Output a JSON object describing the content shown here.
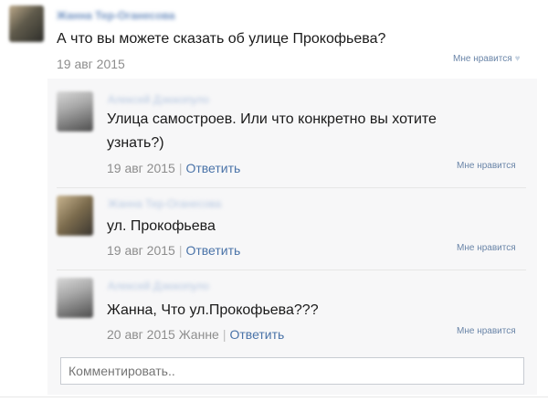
{
  "post": {
    "author": "Жанна Тер-Оганесова",
    "text": "А что вы можете сказать об улице Прокофьева?",
    "date": "19 авг 2015",
    "like_label": "Мне нравится"
  },
  "replies": [
    {
      "author": "Алексей Дзюкопуло",
      "text": "Улица самостроев. Или что конкретно вы хотите узнать?)",
      "date": "19 авг 2015",
      "reply_label": "Ответить",
      "like_label": "Мне нравится"
    },
    {
      "author": "Жанна Тер-Оганесова",
      "text": "ул. Прокофьева",
      "date": "19 авг 2015",
      "reply_label": "Ответить",
      "like_label": "Мне нравится"
    },
    {
      "author": "Алексей Дзюкопуло",
      "text": "Жанна, Что ул.Прокофьева???",
      "date": "20 авг 2015",
      "addressee": "Жанне",
      "reply_label": "Ответить",
      "like_label": "Мне нравится"
    }
  ],
  "comment_input": {
    "placeholder": "Комментировать.."
  },
  "colors": {
    "link": "#4a73a8",
    "author": "#6d8fbf",
    "meta": "#8d8d8d",
    "reply_bg": "#f7f7f8"
  }
}
